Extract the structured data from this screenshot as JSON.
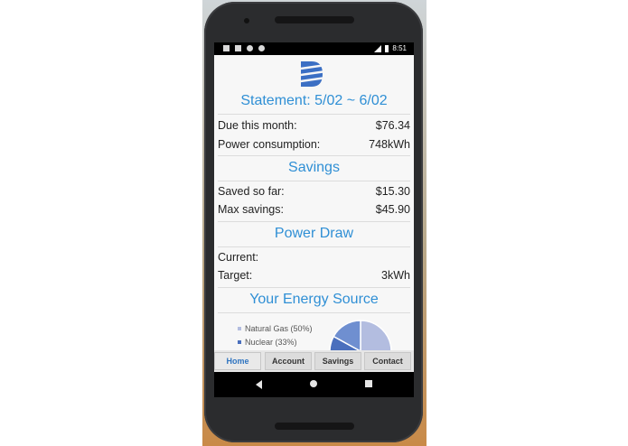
{
  "statusbar": {
    "time": "8:51"
  },
  "statement": {
    "title": "Statement: 5/02 ~ 6/02"
  },
  "bill": {
    "due_label": "Due this month:",
    "due_value": "$76.34",
    "consumption_label": "Power consumption:",
    "consumption_value": "748kWh"
  },
  "savings": {
    "title": "Savings",
    "saved_label": "Saved so far:",
    "saved_value": "$15.30",
    "max_label": "Max savings:",
    "max_value": "$45.90"
  },
  "power_draw": {
    "title": "Power Draw",
    "current_label": "Current:",
    "current_value": "",
    "target_label": "Target:",
    "target_value": "3kWh"
  },
  "energy_source": {
    "title": "Your Energy Source",
    "legend": [
      {
        "label": "Natural Gas (50%)",
        "color": "#b3bde0",
        "percent": 50
      },
      {
        "label": "Nuclear (33%)",
        "color": "#4a6fbd",
        "percent": 33
      }
    ]
  },
  "tabs": [
    "Home",
    "Account",
    "Savings",
    "Contact"
  ],
  "colors": {
    "accent": "#2f8fd5",
    "tab_active": "#2f74c0",
    "logo": "#3b6fc4"
  }
}
